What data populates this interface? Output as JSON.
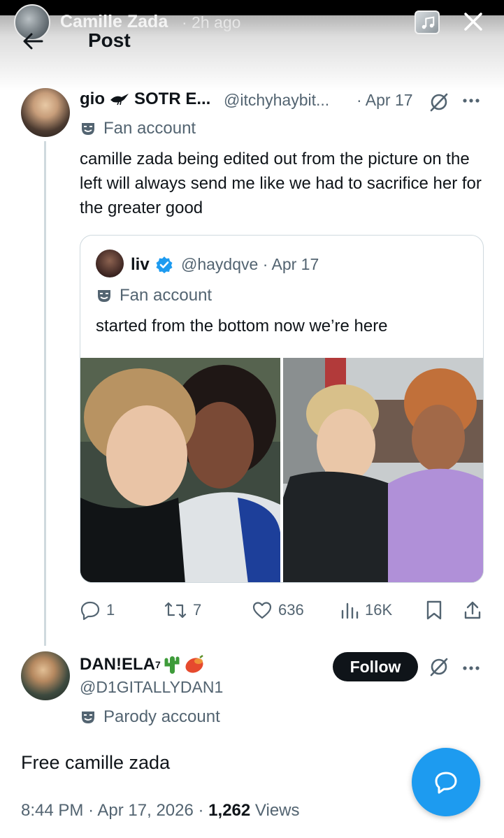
{
  "story": {
    "username": "Camille Zada",
    "time": "· 2h ago"
  },
  "header": {
    "title": "Post"
  },
  "original_post": {
    "display_name": "gio",
    "display_name_suffix": "SOTR E...",
    "handle": "@itchyhaybit...",
    "date": "· Apr 17",
    "account_label": "Fan account",
    "text": "camille zada being edited out from the picture on the left will always send me like we had to sacrifice her for the greater good",
    "quoted": {
      "display_name": "liv",
      "handle": "@haydqve",
      "date": "· Apr 17",
      "account_label": "Fan account",
      "text": "started from the bottom now we’re here"
    },
    "stats": {
      "replies": "1",
      "reposts": "7",
      "likes": "636",
      "views": "16K"
    }
  },
  "reply": {
    "display_name": "DAN!ELA",
    "superscript": "7",
    "handle": "@D1GITALLYDAN1",
    "follow_label": "Follow",
    "account_label": "Parody account",
    "text": "Free camille zada",
    "time": "8:44 PM",
    "date": "· Apr 17, 2026 ·",
    "views_count": "1,262",
    "views_label": "Views"
  },
  "colors": {
    "accent": "#1d9bf0",
    "secondary_text": "#536471",
    "primary_text": "#0f1419"
  }
}
